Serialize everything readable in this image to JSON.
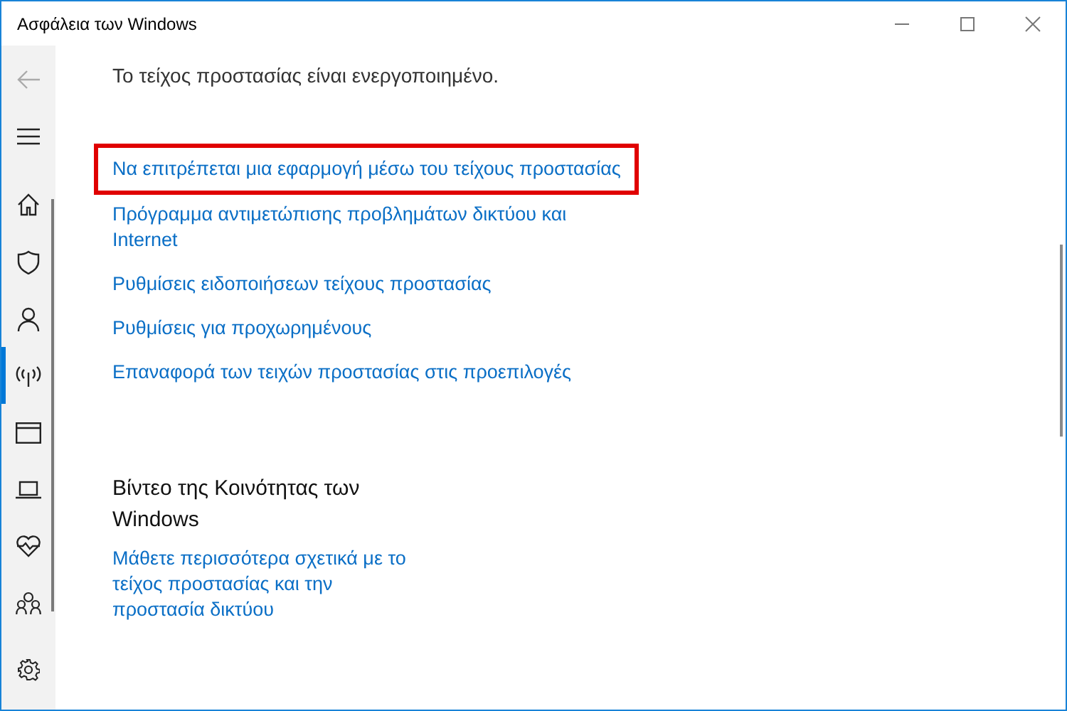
{
  "window": {
    "title": "Ασφάλεια των Windows"
  },
  "nav": [
    {
      "kind": "back",
      "disabled": true
    },
    {
      "kind": "menu"
    },
    {
      "kind": "home",
      "selected": false
    },
    {
      "kind": "shield",
      "selected": false
    },
    {
      "kind": "person",
      "selected": false
    },
    {
      "kind": "antenna",
      "selected": true
    },
    {
      "kind": "browser",
      "selected": false
    },
    {
      "kind": "laptop",
      "selected": false
    },
    {
      "kind": "heart",
      "selected": false
    },
    {
      "kind": "family",
      "selected": false
    }
  ],
  "status_text": "Το τείχος προστασίας είναι ενεργοποιημένο.",
  "links": [
    {
      "text": "Να επιτρέπεται μια εφαρμογή μέσω του τείχους προστασίας",
      "highlighted": true
    },
    {
      "text": "Πρόγραμμα αντιμετώπισης προβλημάτων δικτύου και Internet",
      "highlighted": false
    },
    {
      "text": "Ρυθμίσεις ειδοποιήσεων τείχους προστασίας",
      "highlighted": false
    },
    {
      "text": "Ρυθμίσεις για προχωρημένους",
      "highlighted": false
    },
    {
      "text": "Επαναφορά των τειχών προστασίας στις προεπιλογές",
      "highlighted": false
    }
  ],
  "community": {
    "title": "Βίντεο της Κοινότητας των Windows",
    "link": "Μάθετε περισσότερα σχετικά με το τείχος προστασίας και την προστασία δικτύου"
  }
}
